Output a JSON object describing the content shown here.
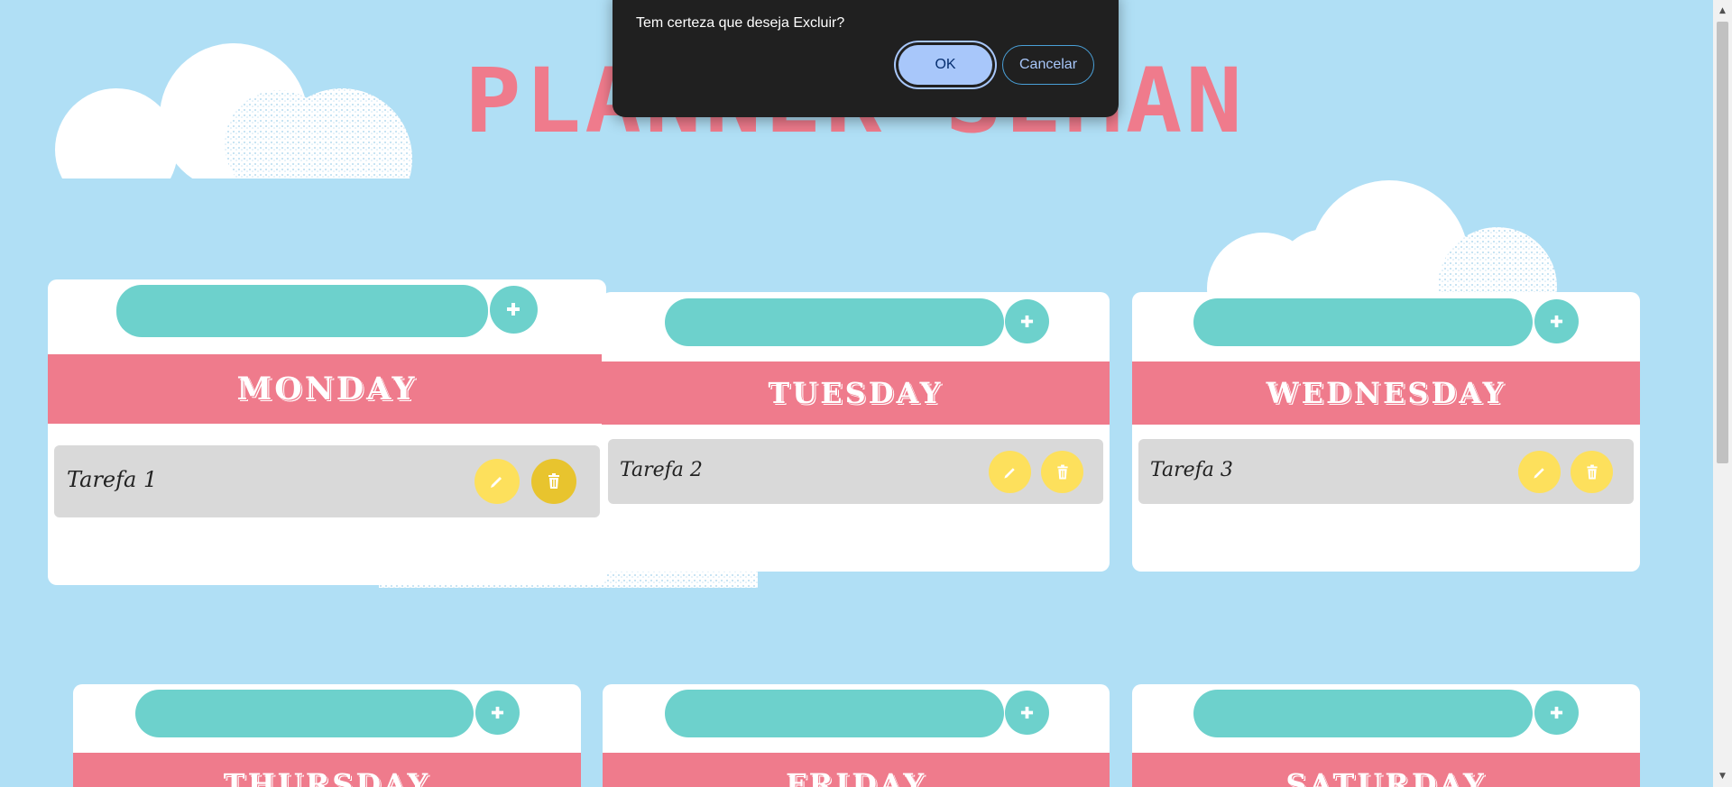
{
  "title": "PLANNER SEMANAL",
  "dialog": {
    "message": "Tem certeza que deseja Excluir?",
    "ok_label": "OK",
    "cancel_label": "Cancelar"
  },
  "add_icon": "plus-icon",
  "days": [
    {
      "name": "MONDAY",
      "input_value": "",
      "tasks": [
        {
          "label": "Tarefa 1"
        }
      ]
    },
    {
      "name": "TUESDAY",
      "input_value": "",
      "tasks": [
        {
          "label": "Tarefa 2"
        }
      ]
    },
    {
      "name": "WEDNESDAY",
      "input_value": "",
      "tasks": [
        {
          "label": "Tarefa 3"
        }
      ]
    },
    {
      "name": "THURSDAY",
      "input_value": "",
      "tasks": []
    },
    {
      "name": "FRIDAY",
      "input_value": "",
      "tasks": []
    },
    {
      "name": "SATURDAY",
      "input_value": "",
      "tasks": []
    }
  ],
  "colors": {
    "background": "#b0dff5",
    "accent_teal": "#6dd1cc",
    "banner_pink": "#ef7b8c",
    "button_yellow": "#fde05c",
    "task_gray": "#d9d9d9"
  }
}
